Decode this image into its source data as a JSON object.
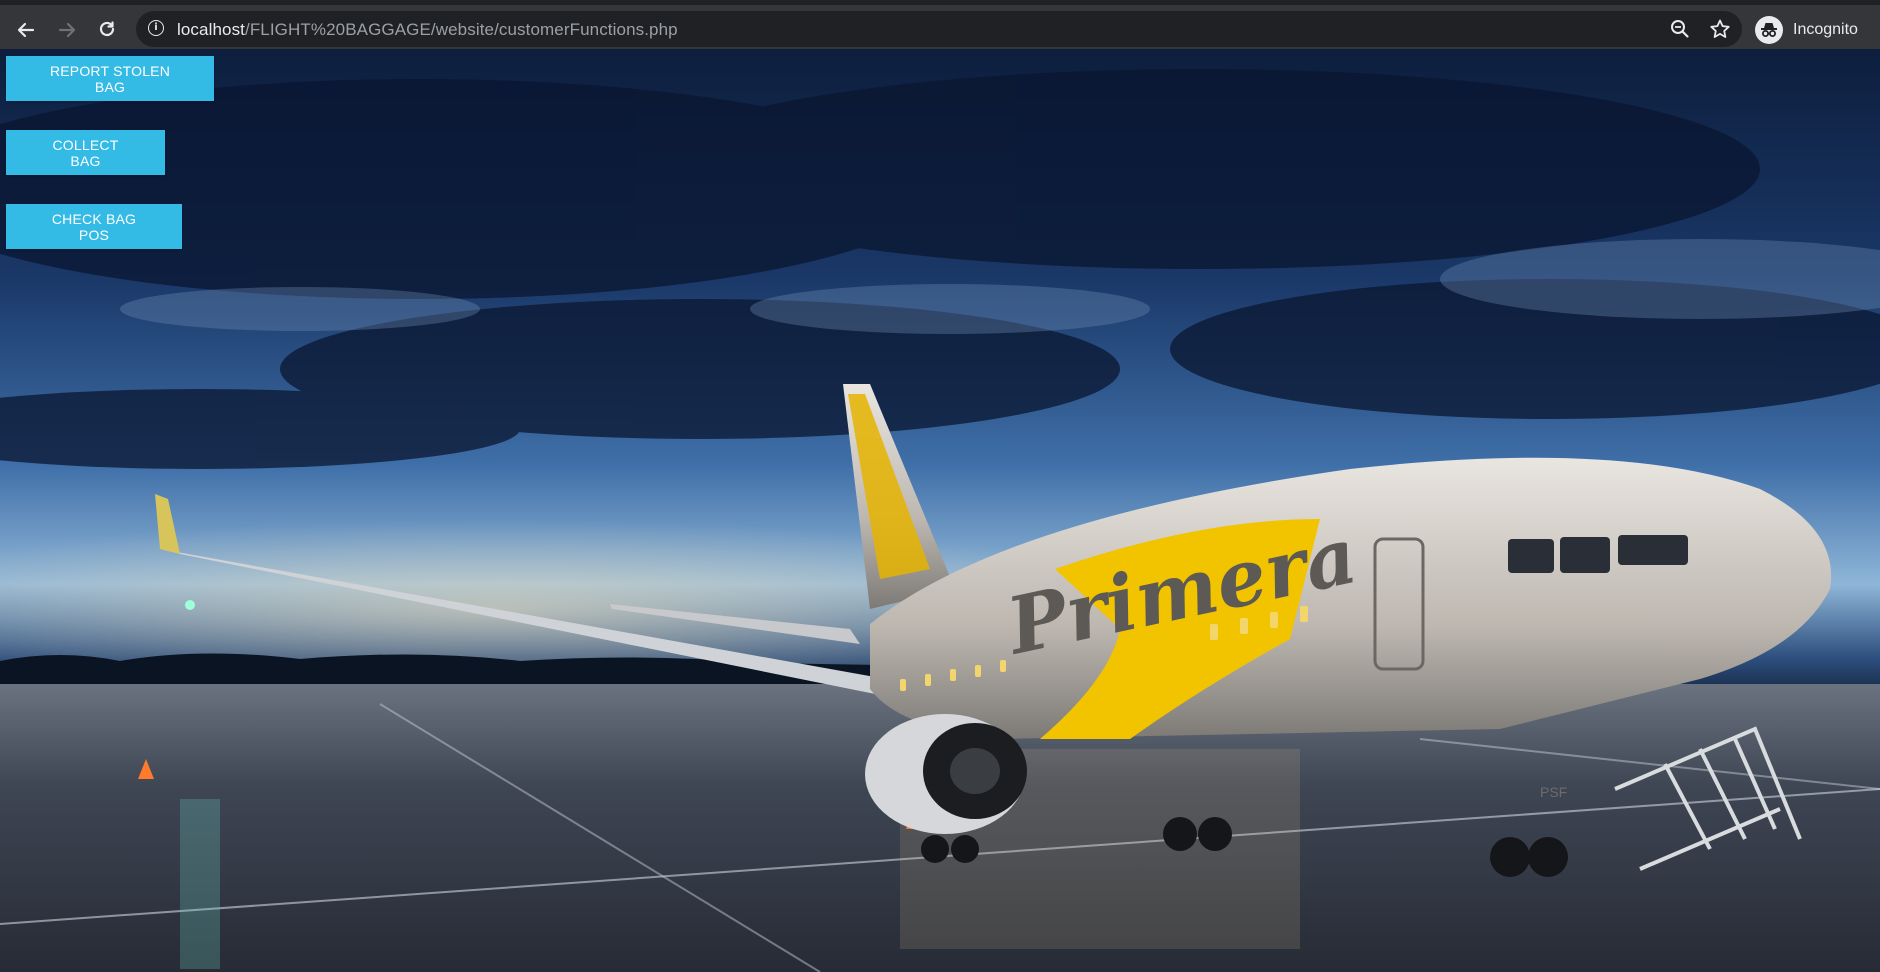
{
  "browser": {
    "url_host": "localhost",
    "url_path": "/FLIGHT%20BAGGAGE/website/customerFunctions.php",
    "profile_label": "Incognito",
    "icons": {
      "back": "back-arrow-icon",
      "forward": "forward-arrow-icon",
      "reload": "reload-icon",
      "info": "info-icon",
      "zoom": "zoom-icon",
      "bookmark": "star-icon",
      "incognito": "incognito-icon"
    }
  },
  "page": {
    "buttons": {
      "report_stolen": "REPORT STOLEN BAG",
      "collect": "COLLECT BAG",
      "check_pos": "CHECK BAG POS"
    },
    "background": {
      "airline_livery_text": "Primera",
      "registration_text": "PSF"
    }
  },
  "colors": {
    "button_bg": "#33bbe6",
    "button_text": "#ffffff",
    "chrome_bg": "#35363a",
    "omnibox_bg": "#202124",
    "livery_yellow": "#f2c400"
  }
}
